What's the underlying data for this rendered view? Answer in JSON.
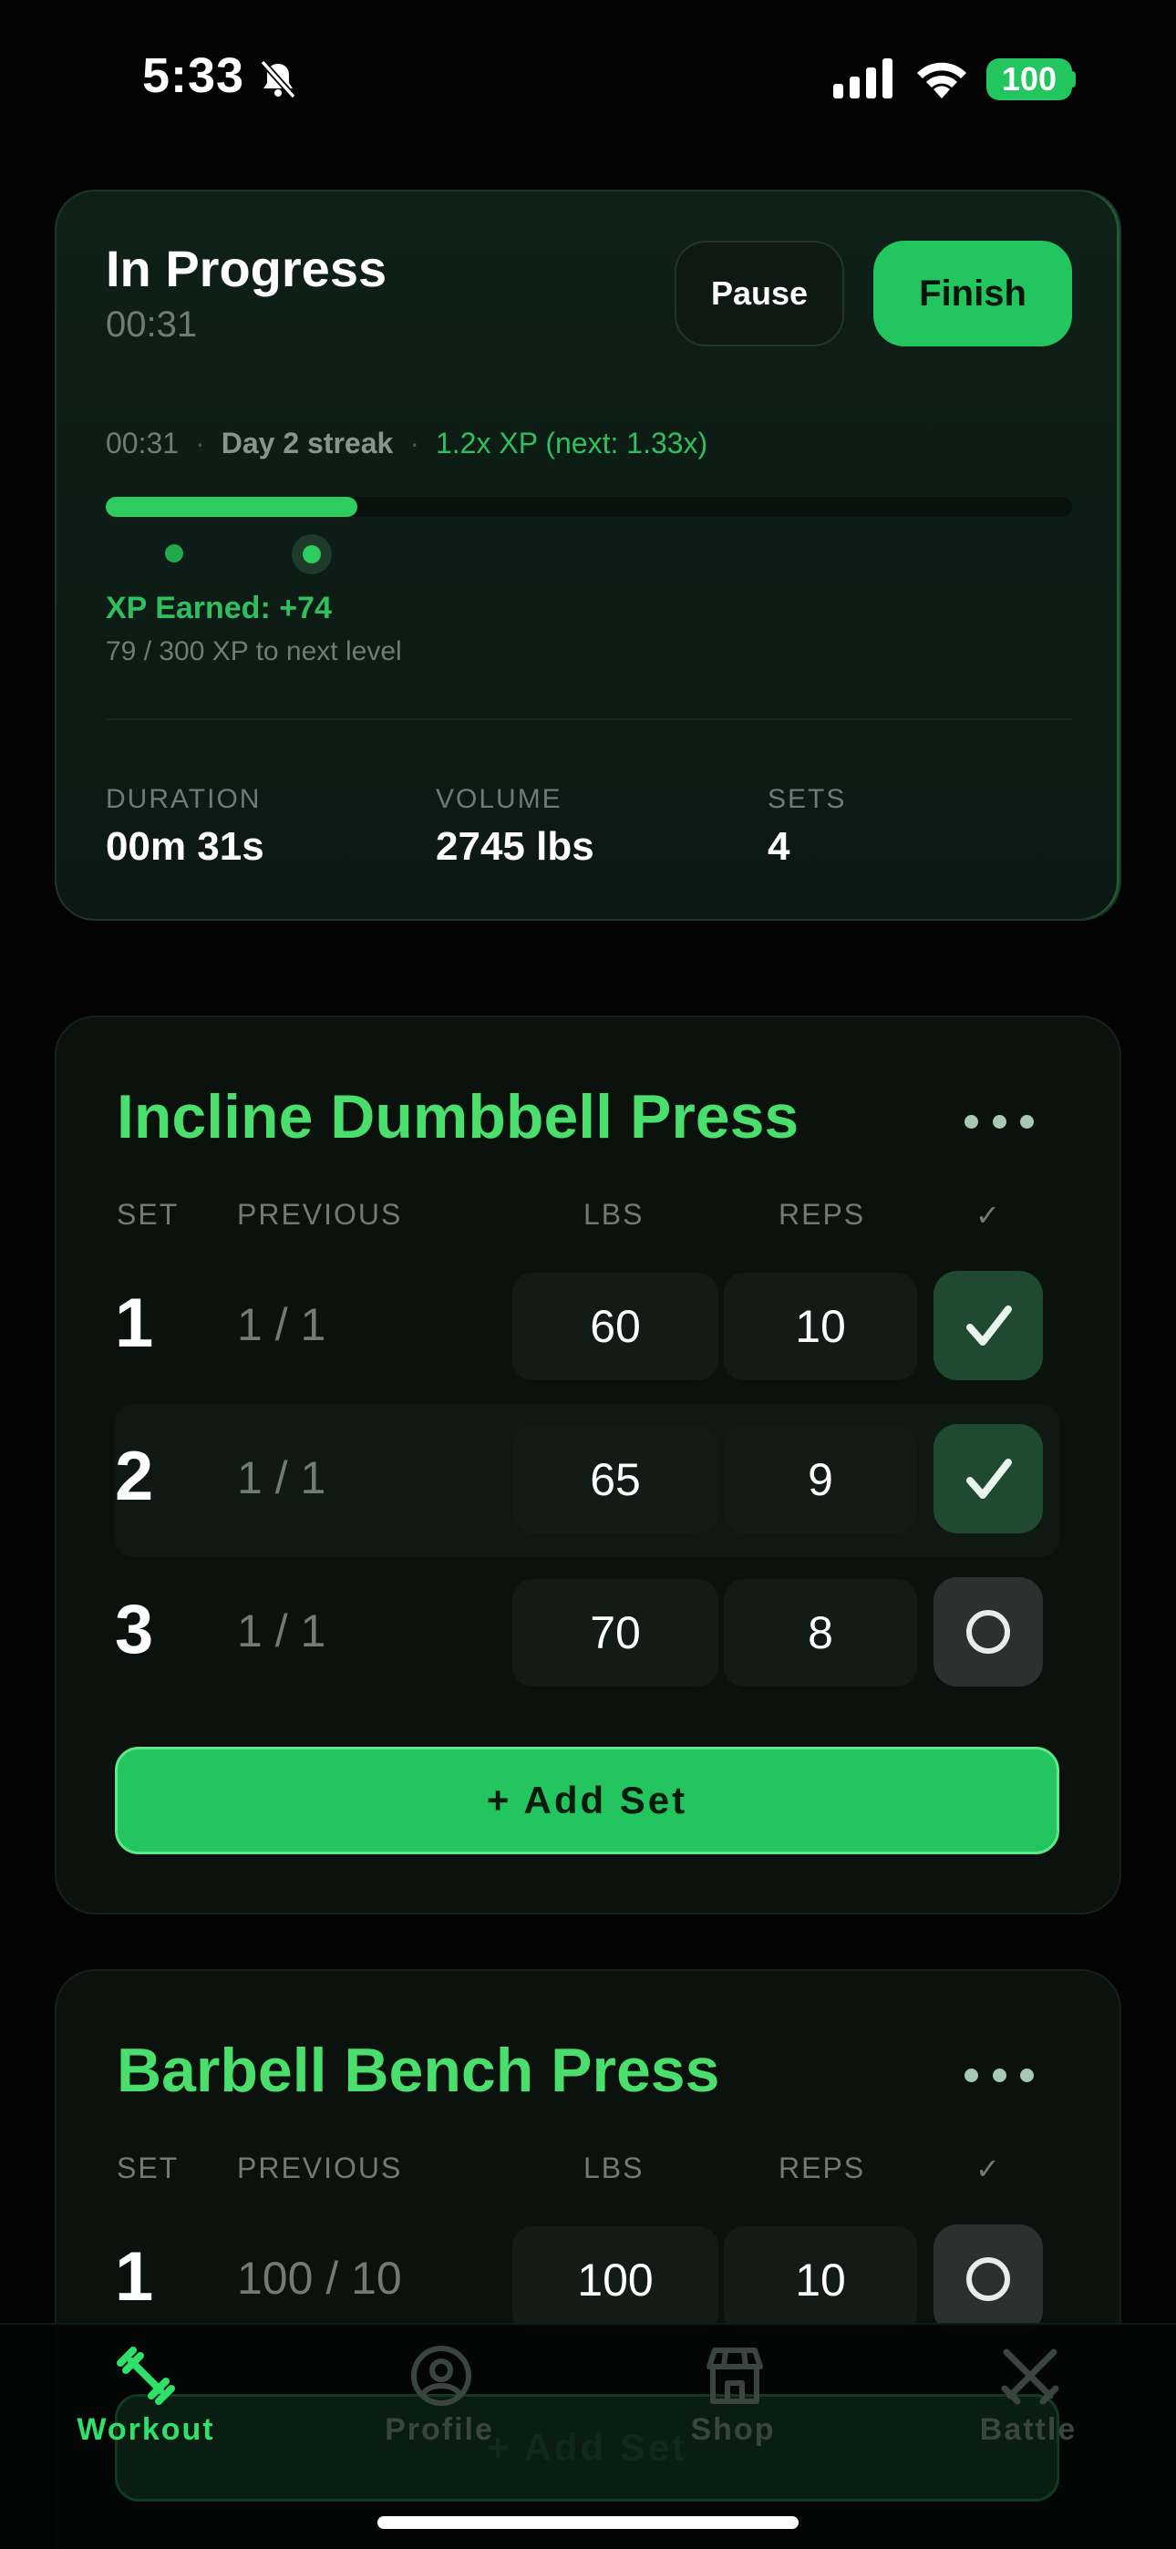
{
  "status_bar": {
    "time": "5:33",
    "battery": "100"
  },
  "session": {
    "title": "In Progress",
    "elapsed": "00:31",
    "pause_label": "Pause",
    "finish_label": "Finish",
    "meta_time": "00:31",
    "streak": "Day 2 streak",
    "multiplier": "1.2x XP (next: 1.33x)",
    "xp_progress": 0.26,
    "xp_earned": "XP Earned: +74",
    "xp_to_next": "79 / 300 XP to next level",
    "stats": [
      {
        "label": "DURATION",
        "value": "00m 31s"
      },
      {
        "label": "VOLUME",
        "value": "2745 lbs"
      },
      {
        "label": "SETS",
        "value": "4"
      }
    ]
  },
  "columns": {
    "set": "SET",
    "previous": "PREVIOUS",
    "lbs": "LBS",
    "reps": "REPS",
    "check": "✓"
  },
  "exercises": [
    {
      "name": "Incline Dumbbell Press",
      "add_set_label": "+ Add Set",
      "sets": [
        {
          "num": "1",
          "previous": "1 / 1",
          "lbs": "60",
          "reps": "10",
          "done": true
        },
        {
          "num": "2",
          "previous": "1 / 1",
          "lbs": "65",
          "reps": "9",
          "done": true
        },
        {
          "num": "3",
          "previous": "1 / 1",
          "lbs": "70",
          "reps": "8",
          "done": false
        }
      ]
    },
    {
      "name": "Barbell Bench Press",
      "add_set_label": "+ Add Set",
      "sets": [
        {
          "num": "1",
          "previous": "100 / 10",
          "lbs": "100",
          "reps": "10",
          "done": false
        }
      ]
    }
  ],
  "tabs": [
    {
      "label": "Workout",
      "icon": "dumbbell-icon",
      "active": true
    },
    {
      "label": "Profile",
      "icon": "user-circle-icon",
      "active": false
    },
    {
      "label": "Shop",
      "icon": "store-icon",
      "active": false
    },
    {
      "label": "Battle",
      "icon": "crossed-swords-icon",
      "active": false
    }
  ],
  "colors": {
    "accent": "#22c55e",
    "accent_text": "#4ade6c",
    "muted": "#6f7b74",
    "background": "#030303"
  }
}
